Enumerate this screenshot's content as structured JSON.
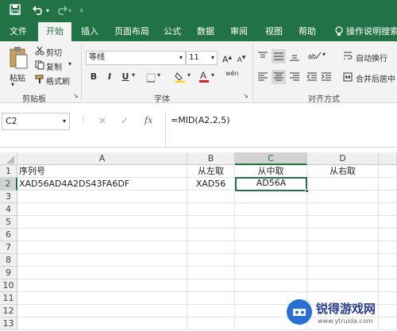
{
  "quick_access": {
    "save": "save-icon",
    "undo": "undo-icon",
    "redo": "redo-icon",
    "customize": "dropdown-icon"
  },
  "tabs": [
    {
      "label": "文件"
    },
    {
      "label": "开始"
    },
    {
      "label": "插入"
    },
    {
      "label": "页面布局"
    },
    {
      "label": "公式"
    },
    {
      "label": "数据"
    },
    {
      "label": "审阅"
    },
    {
      "label": "视图"
    },
    {
      "label": "帮助"
    },
    {
      "label": "操作说明搜索"
    }
  ],
  "ribbon": {
    "clipboard": {
      "paste": "粘贴",
      "cut": "剪切",
      "copy": "复制",
      "format_painter": "格式刷",
      "group": "剪贴板"
    },
    "font": {
      "name": "等线",
      "size": "11",
      "bold": "B",
      "italic": "I",
      "underline": "U",
      "group": "字体"
    },
    "alignment": {
      "wrap": "自动换行",
      "merge": "合并后居中",
      "group": "对齐方式"
    }
  },
  "formula_bar": {
    "name_box": "C2",
    "cancel": "✕",
    "enter": "✓",
    "fx": "fx",
    "formula": "=MID(A2,2,5)"
  },
  "grid": {
    "columns": [
      "A",
      "B",
      "C",
      "D"
    ],
    "rows": [
      "1",
      "2",
      "3",
      "4",
      "5",
      "6",
      "7",
      "8",
      "9",
      "10",
      "11",
      "12",
      "13"
    ],
    "cells": {
      "A1": "序列号",
      "B1": "从左取",
      "C1": "从中取",
      "D1": "从右取",
      "A2": "XAD56AD4A2DS43FA6DF",
      "B2": "XAD56",
      "C2": "AD56A"
    },
    "active_cell": "C2"
  },
  "watermark": {
    "text": "锐得游戏网",
    "url": "www.ytruida.com"
  }
}
